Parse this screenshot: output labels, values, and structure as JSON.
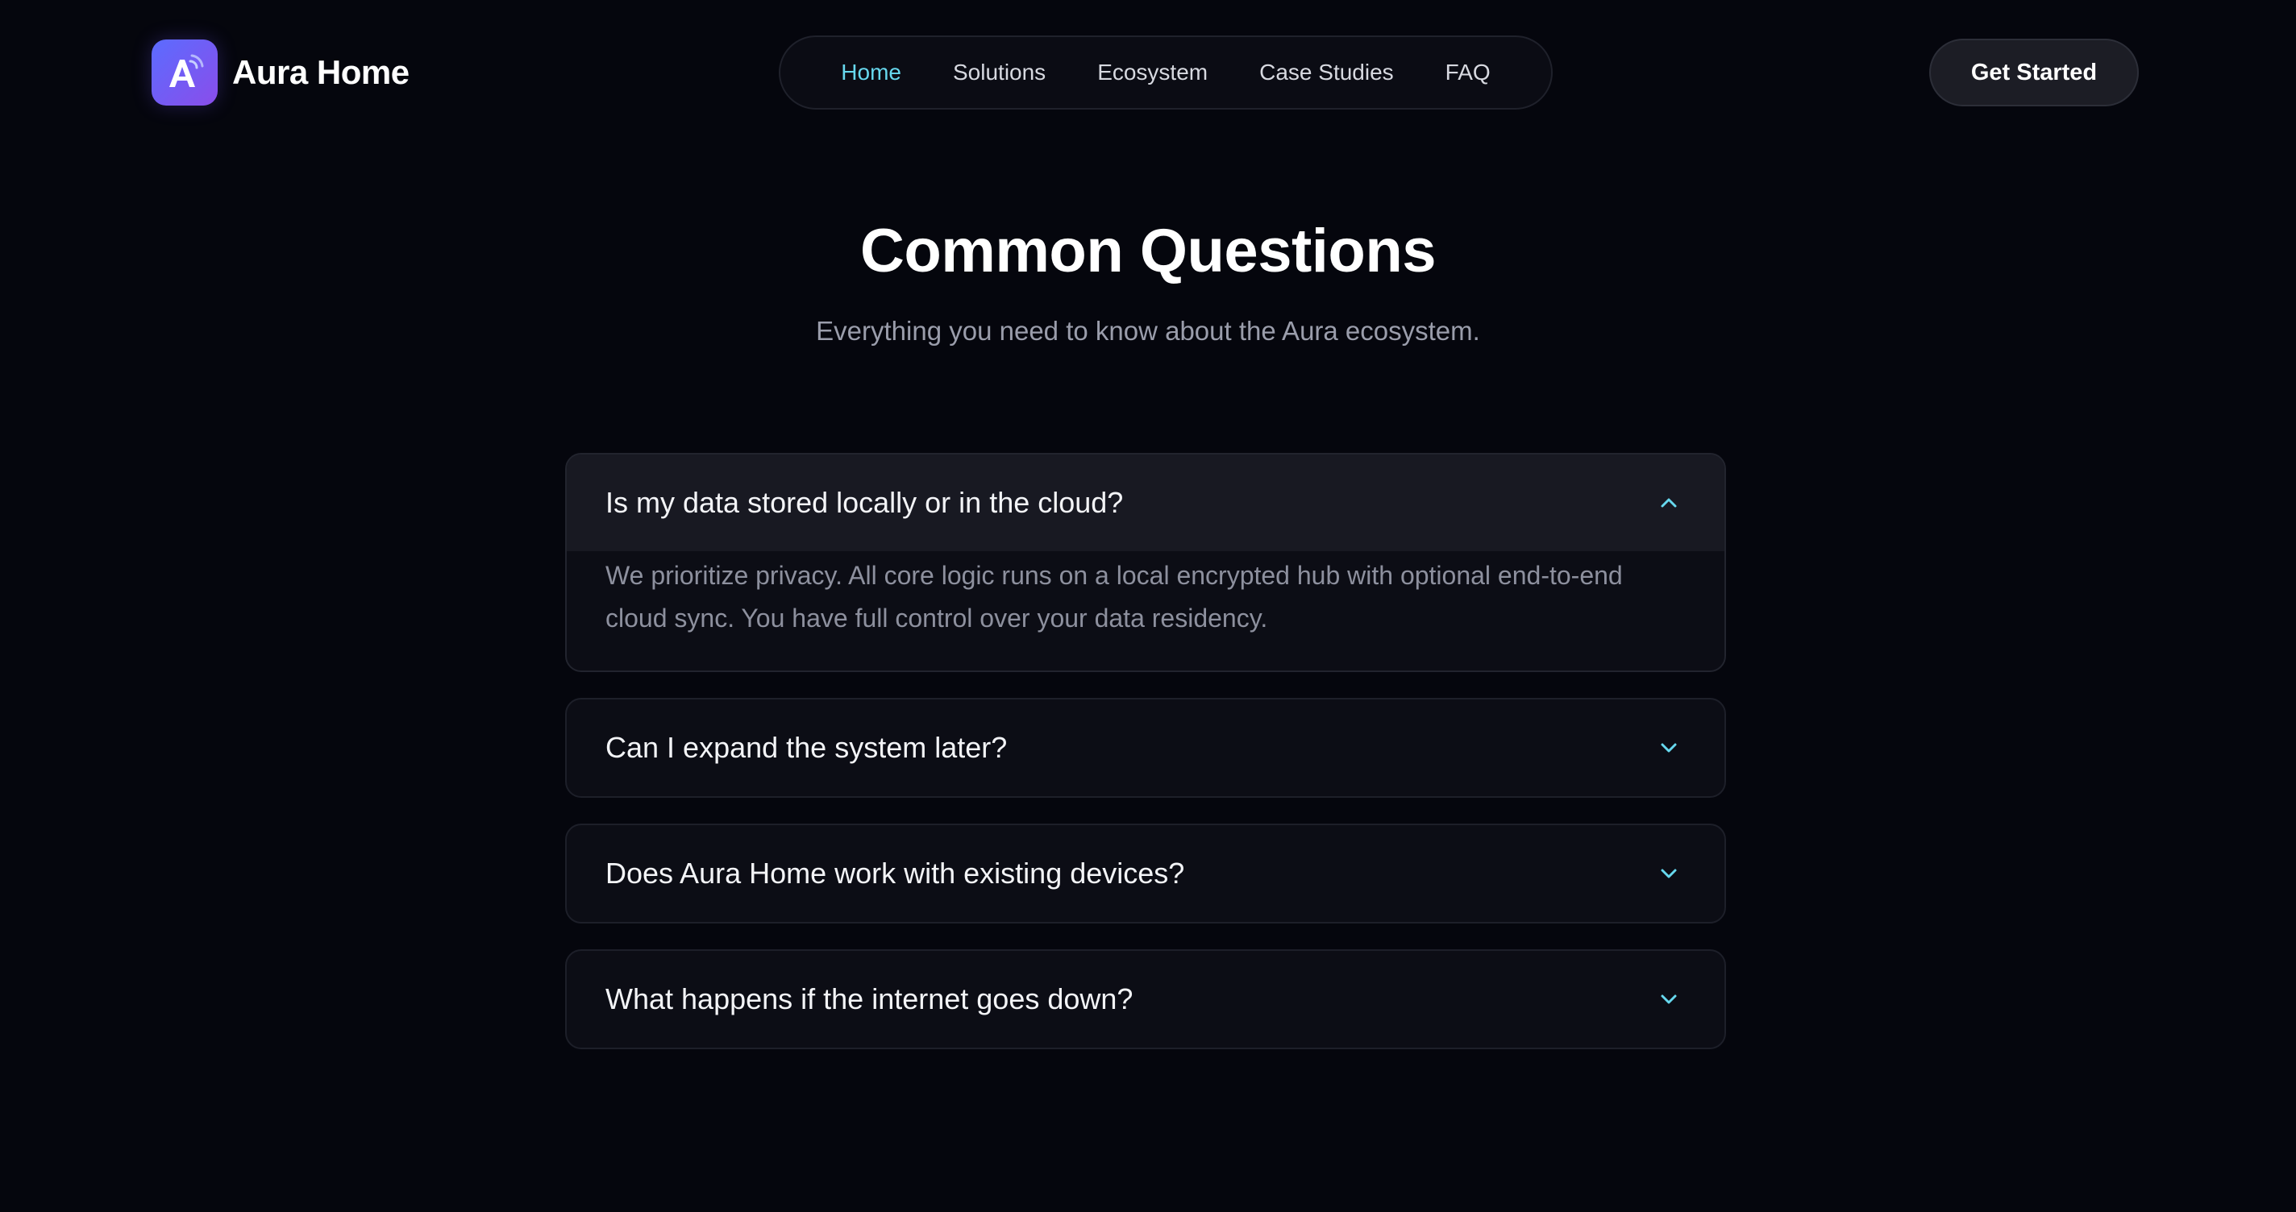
{
  "brand": {
    "name": "Aura Home",
    "logo_letter": "A"
  },
  "nav": {
    "items": [
      {
        "label": "Home",
        "active": true
      },
      {
        "label": "Solutions",
        "active": false
      },
      {
        "label": "Ecosystem",
        "active": false
      },
      {
        "label": "Case Studies",
        "active": false
      },
      {
        "label": "FAQ",
        "active": false
      }
    ]
  },
  "cta": {
    "label": "Get Started"
  },
  "hero": {
    "title": "Common Questions",
    "subtitle": "Everything you need to know about the Aura ecosystem."
  },
  "faq": {
    "items": [
      {
        "question": "Is my data stored locally or in the cloud?",
        "answer": "We prioritize privacy. All core logic runs on a local encrypted hub with optional end-to-end cloud sync. You have full control over your data residency.",
        "expanded": true,
        "icon": "chevron-up-icon"
      },
      {
        "question": "Can I expand the system later?",
        "expanded": false,
        "icon": "chevron-down-icon"
      },
      {
        "question": "Does Aura Home work with existing devices?",
        "expanded": false,
        "icon": "chevron-down-icon"
      },
      {
        "question": "What happens if the internet goes down?",
        "expanded": false,
        "icon": "chevron-down-icon"
      }
    ]
  },
  "colors": {
    "background": "#05060d",
    "accent": "#67d8ee",
    "logo_gradient_start": "#5b6cff",
    "logo_gradient_end": "#8a4dea",
    "card": "#0c0d15",
    "card_open_header": "#181922",
    "muted_text": "#9a9dab"
  }
}
